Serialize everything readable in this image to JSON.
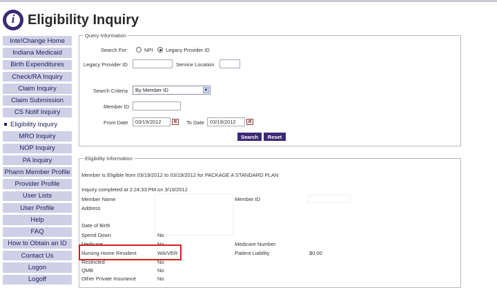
{
  "header": {
    "title": "Eligibility Inquiry",
    "logo_letter": "i"
  },
  "nav": [
    {
      "label": "Inte!Change Home",
      "name": "nav-interchange-home"
    },
    {
      "label": "Indiana Medicaid",
      "name": "nav-indiana-medicaid"
    },
    {
      "label": "Birth Expenditures",
      "name": "nav-birth-expenditures"
    },
    {
      "label": "Check/RA Inquiry",
      "name": "nav-check-ra-inquiry"
    },
    {
      "label": "Claim Inquiry",
      "name": "nav-claim-inquiry"
    },
    {
      "label": "Claim Submission",
      "name": "nav-claim-submission"
    },
    {
      "label": "CS Notif Inquiry",
      "name": "nav-cs-notif-inquiry"
    },
    {
      "label": "Eligibility Inquiry",
      "name": "nav-eligibility-inquiry",
      "active": true
    },
    {
      "label": "MRO Inquiry",
      "name": "nav-mro-inquiry"
    },
    {
      "label": "NOP Inquiry",
      "name": "nav-nop-inquiry"
    },
    {
      "label": "PA Inquiry",
      "name": "nav-pa-inquiry"
    },
    {
      "label": "Pharm Member Profile",
      "name": "nav-pharm-member-profile"
    },
    {
      "label": "Provider Profile",
      "name": "nav-provider-profile"
    },
    {
      "label": "User Lists",
      "name": "nav-user-lists"
    },
    {
      "label": "User Profile",
      "name": "nav-user-profile"
    },
    {
      "label": "Help",
      "name": "nav-help"
    },
    {
      "label": "FAQ",
      "name": "nav-faq"
    },
    {
      "label": "How to Obtain an ID",
      "name": "nav-how-to-obtain-id"
    },
    {
      "label": "Contact Us",
      "name": "nav-contact-us"
    },
    {
      "label": "Logon",
      "name": "nav-logon"
    },
    {
      "label": "Logoff",
      "name": "nav-logoff"
    }
  ],
  "query": {
    "legend": "Query Information",
    "search_for_label": "Search For:",
    "npi_label": "NPI",
    "legacy_label": "Legacy Provider ID",
    "legacy_id_label": "Legacy Provider ID",
    "service_location_label": "Service Location",
    "criteria_label": "Search Criteria",
    "criteria_value": "By Member ID",
    "member_id_label": "Member ID",
    "from_date_label": "From Date",
    "from_date_value": "03/19/2012",
    "to_date_label": "To Date",
    "to_date_value": "03/19/2012",
    "search_button": "Search",
    "reset_button": "Reset"
  },
  "elig": {
    "legend": "Eligibility Information",
    "eligible_msg": "Member is Eligible from 03/19/2012 to 03/19/2012 for PACKAGE A STANDARD PLAN",
    "completed_msg": "Inquiry completed at 2:24:33 PM on 3/19/2012",
    "member_name_label": "Member Name",
    "member_id_label": "Member ID",
    "address_label": "Address",
    "dob_label": "Date of Birth",
    "spend_down_label": "Spend Down",
    "spend_down_value": "No",
    "medicare_label": "Medicare",
    "medicare_value": "No",
    "medicare_number_label": "Medicare Number",
    "nursing_label": "Nursing Home Resident",
    "nursing_value": "WAIVER",
    "patient_liability_label": "Patient Liability",
    "patient_liability_value": "$0.00",
    "restricted_label": "Restricted",
    "restricted_value": "No",
    "qmb_label": "QMB",
    "qmb_value": "No",
    "other_ins_label": "Other Private Insurance",
    "other_ins_value": "No"
  },
  "colors": {
    "accent": "#3b2a74",
    "nav_bg": "#cfcfe6",
    "highlight": "#d21e1e"
  }
}
